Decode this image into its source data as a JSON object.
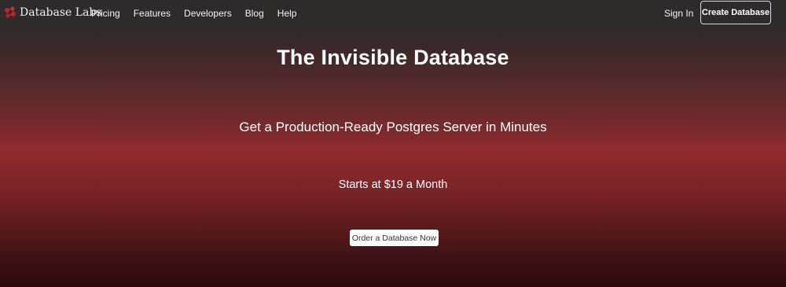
{
  "navbar": {
    "brand": "Database Labs",
    "links": [
      "Pricing",
      "Features",
      "Developers",
      "Blog",
      "Help"
    ],
    "sign_in": "Sign In",
    "create_button": "Create Database"
  },
  "hero": {
    "title": "The Invisible Database",
    "subtitle": "Get a Production-Ready Postgres Server in Minutes",
    "price_line": "Starts at $19 a Month",
    "cta_button": "Order a Database Now"
  },
  "colors": {
    "nav_background": "#2f2b2b",
    "hero_accent": "#912b2e",
    "logo_red": "#b8272b"
  },
  "icons": {
    "brand_logo": "molecule-logo-icon"
  }
}
